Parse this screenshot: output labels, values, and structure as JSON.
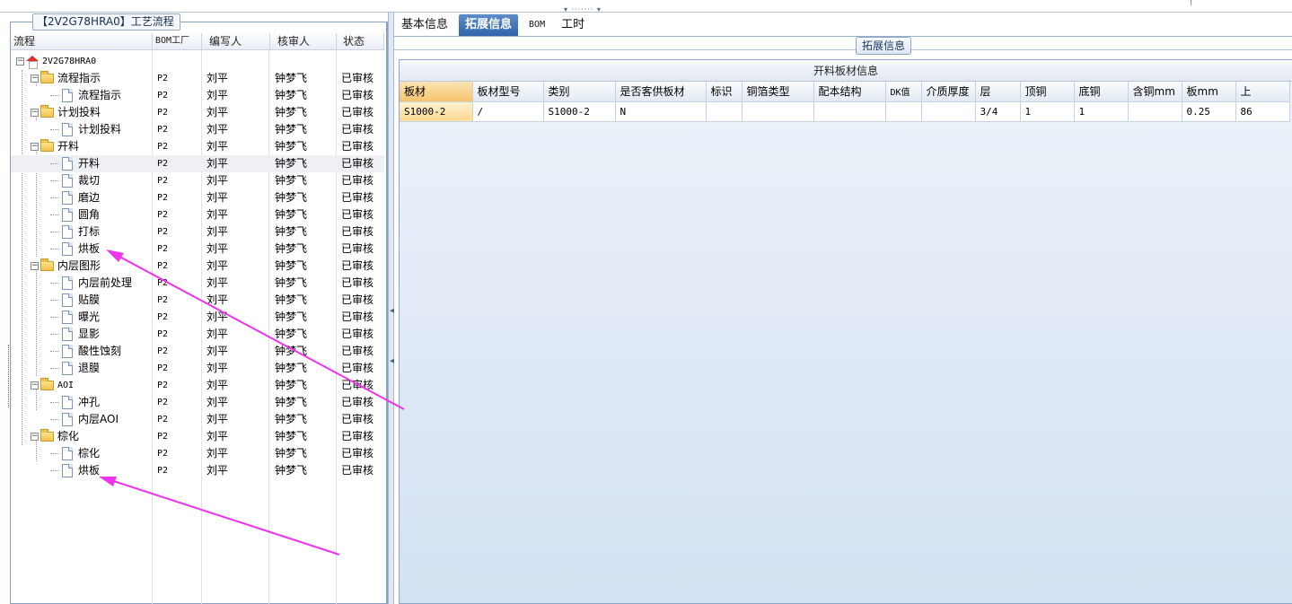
{
  "left_panel": {
    "title": "【2V2G78HRA0】工艺流程",
    "columns": [
      "流程",
      "BOM工厂",
      "编写人",
      "核审人",
      "状态"
    ],
    "root_label": "2V2G78HRA0",
    "rows": [
      {
        "label": "流程指示",
        "bom": "P2",
        "writer": "刘平",
        "reviewer": "钟梦飞",
        "status": "已审核"
      },
      {
        "label": "流程指示",
        "bom": "P2",
        "writer": "刘平",
        "reviewer": "钟梦飞",
        "status": "已审核"
      },
      {
        "label": "计划投料",
        "bom": "P2",
        "writer": "刘平",
        "reviewer": "钟梦飞",
        "status": "已审核"
      },
      {
        "label": "计划投料",
        "bom": "P2",
        "writer": "刘平",
        "reviewer": "钟梦飞",
        "status": "已审核"
      },
      {
        "label": "开料",
        "bom": "P2",
        "writer": "刘平",
        "reviewer": "钟梦飞",
        "status": "已审核"
      },
      {
        "label": "开料",
        "bom": "P2",
        "writer": "刘平",
        "reviewer": "钟梦飞",
        "status": "已审核"
      },
      {
        "label": "裁切",
        "bom": "P2",
        "writer": "刘平",
        "reviewer": "钟梦飞",
        "status": "已审核"
      },
      {
        "label": "磨边",
        "bom": "P2",
        "writer": "刘平",
        "reviewer": "钟梦飞",
        "status": "已审核"
      },
      {
        "label": "圆角",
        "bom": "P2",
        "writer": "刘平",
        "reviewer": "钟梦飞",
        "status": "已审核"
      },
      {
        "label": "打标",
        "bom": "P2",
        "writer": "刘平",
        "reviewer": "钟梦飞",
        "status": "已审核"
      },
      {
        "label": "烘板",
        "bom": "P2",
        "writer": "刘平",
        "reviewer": "钟梦飞",
        "status": "已审核"
      },
      {
        "label": "内层图形",
        "bom": "P2",
        "writer": "刘平",
        "reviewer": "钟梦飞",
        "status": "已审核"
      },
      {
        "label": "内层前处理",
        "bom": "P2",
        "writer": "刘平",
        "reviewer": "钟梦飞",
        "status": "已审核"
      },
      {
        "label": "贴膜",
        "bom": "P2",
        "writer": "刘平",
        "reviewer": "钟梦飞",
        "status": "已审核"
      },
      {
        "label": "曝光",
        "bom": "P2",
        "writer": "刘平",
        "reviewer": "钟梦飞",
        "status": "已审核"
      },
      {
        "label": "显影",
        "bom": "P2",
        "writer": "刘平",
        "reviewer": "钟梦飞",
        "status": "已审核"
      },
      {
        "label": "酸性蚀刻",
        "bom": "P2",
        "writer": "刘平",
        "reviewer": "钟梦飞",
        "status": "已审核"
      },
      {
        "label": "退膜",
        "bom": "P2",
        "writer": "刘平",
        "reviewer": "钟梦飞",
        "status": "已审核"
      },
      {
        "label": "AOI",
        "bom": "P2",
        "writer": "刘平",
        "reviewer": "钟梦飞",
        "status": "已审核"
      },
      {
        "label": "冲孔",
        "bom": "P2",
        "writer": "刘平",
        "reviewer": "钟梦飞",
        "status": "已审核"
      },
      {
        "label": "内层AOI",
        "bom": "P2",
        "writer": "刘平",
        "reviewer": "钟梦飞",
        "status": "已审核"
      },
      {
        "label": "棕化",
        "bom": "P2",
        "writer": "刘平",
        "reviewer": "钟梦飞",
        "status": "已审核"
      },
      {
        "label": "棕化",
        "bom": "P2",
        "writer": "刘平",
        "reviewer": "钟梦飞",
        "status": "已审核"
      },
      {
        "label": "烘板",
        "bom": "P2",
        "writer": "刘平",
        "reviewer": "钟梦飞",
        "status": "已审核"
      }
    ]
  },
  "right_panel": {
    "tabs": [
      "基本信息",
      "拓展信息",
      "BOM",
      "工时"
    ],
    "active_tab": "拓展信息",
    "sub_tab": "拓展信息",
    "grid_title": "开料板材信息",
    "columns": [
      "板材",
      "板材型号",
      "类别",
      "是否客供板材",
      "标识",
      "铜箔类型",
      "配本结构",
      "DK值",
      "介质厚度",
      "层",
      "顶铜",
      "底铜",
      "含铜mm",
      "板mm",
      "上"
    ],
    "rows": [
      [
        "S1000-2",
        "/",
        "S1000-2",
        "N",
        "",
        "",
        "",
        "",
        "",
        "3/4",
        "1",
        "1",
        "",
        "0.25",
        "86"
      ]
    ]
  },
  "annotations": {
    "arrow_color": "#ee33ee"
  }
}
